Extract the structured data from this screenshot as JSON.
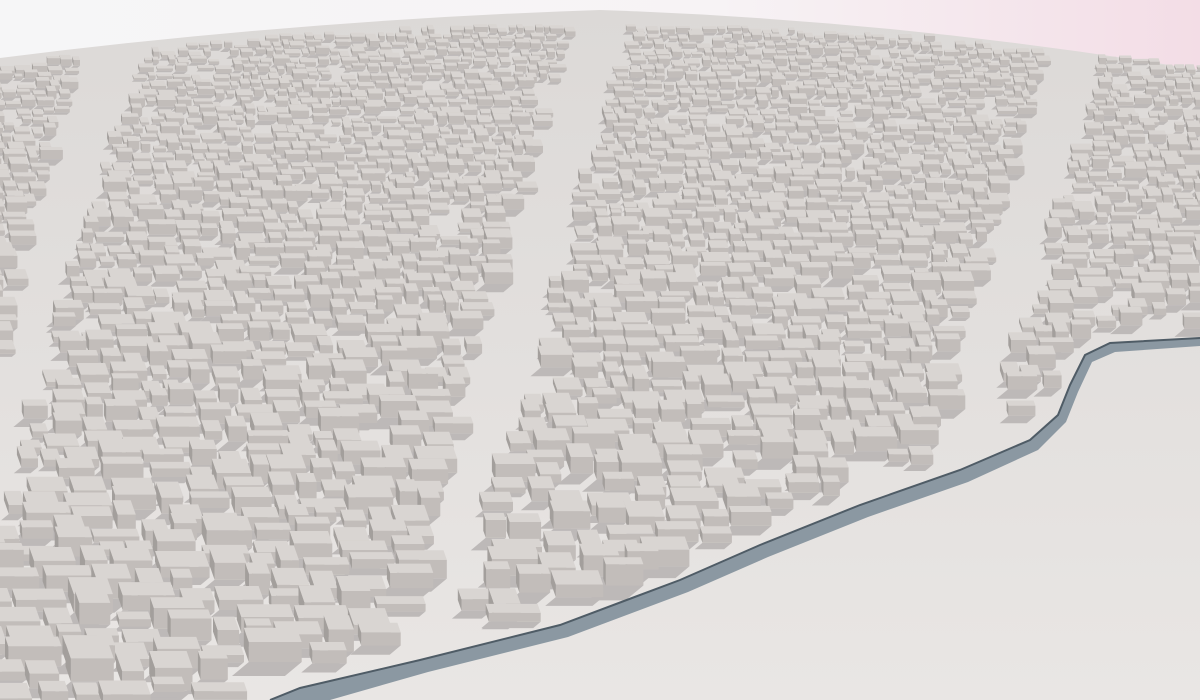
{
  "scene": {
    "colors": {
      "sky_left": "#f6f6f7",
      "sky_right": "#f3dde6",
      "ground": "#e9e6e4",
      "ground_far": "#dcd9d7",
      "roof": "#d9d5d2",
      "wall_light": "#c2bdba",
      "wall_dark": "#a39f9c",
      "shadow": "#bdb9b8",
      "river": "#8b98a2",
      "river_edge": "#4f5c66"
    },
    "density": "high"
  }
}
